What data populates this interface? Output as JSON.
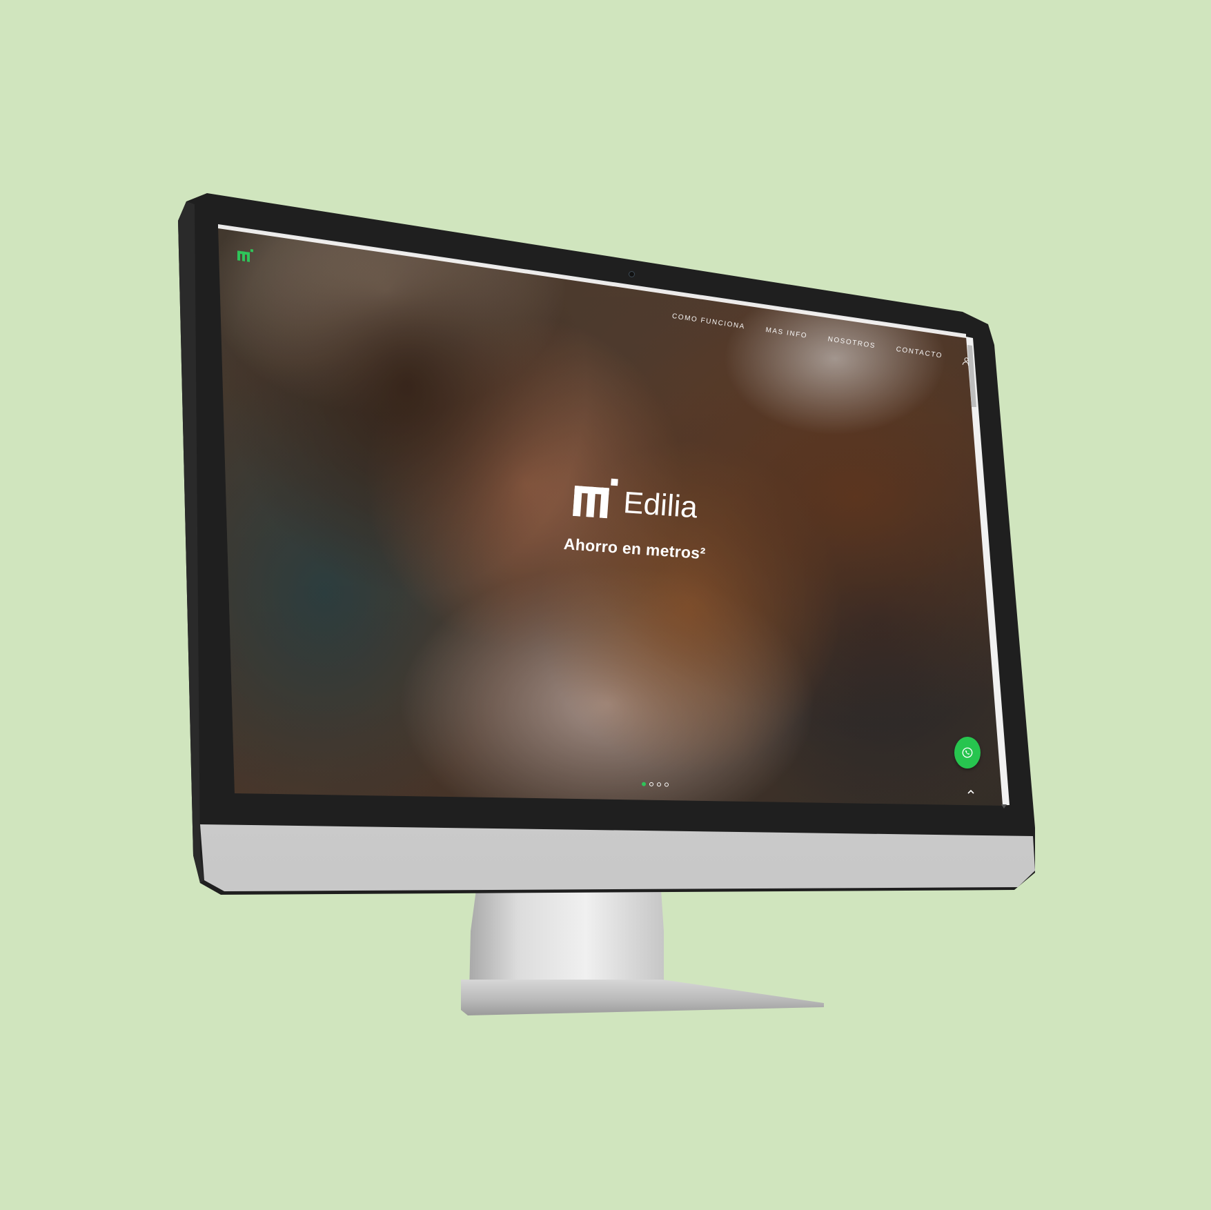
{
  "site": {
    "brand_name": "Edilia",
    "tagline": "Ahorro en metros²",
    "accent_color": "#2fc45a"
  },
  "nav": {
    "items": [
      {
        "label": "COMO FUNCIONA"
      },
      {
        "label": "MAS INFO"
      },
      {
        "label": "NOSOTROS"
      },
      {
        "label": "CONTACTO"
      }
    ],
    "user_icon": "user-icon"
  },
  "slider": {
    "total_slides": 4,
    "active_slide": 1
  },
  "floating": {
    "whatsapp_icon": "whatsapp-icon",
    "scroll_top_icon": "chevron-up-icon"
  }
}
